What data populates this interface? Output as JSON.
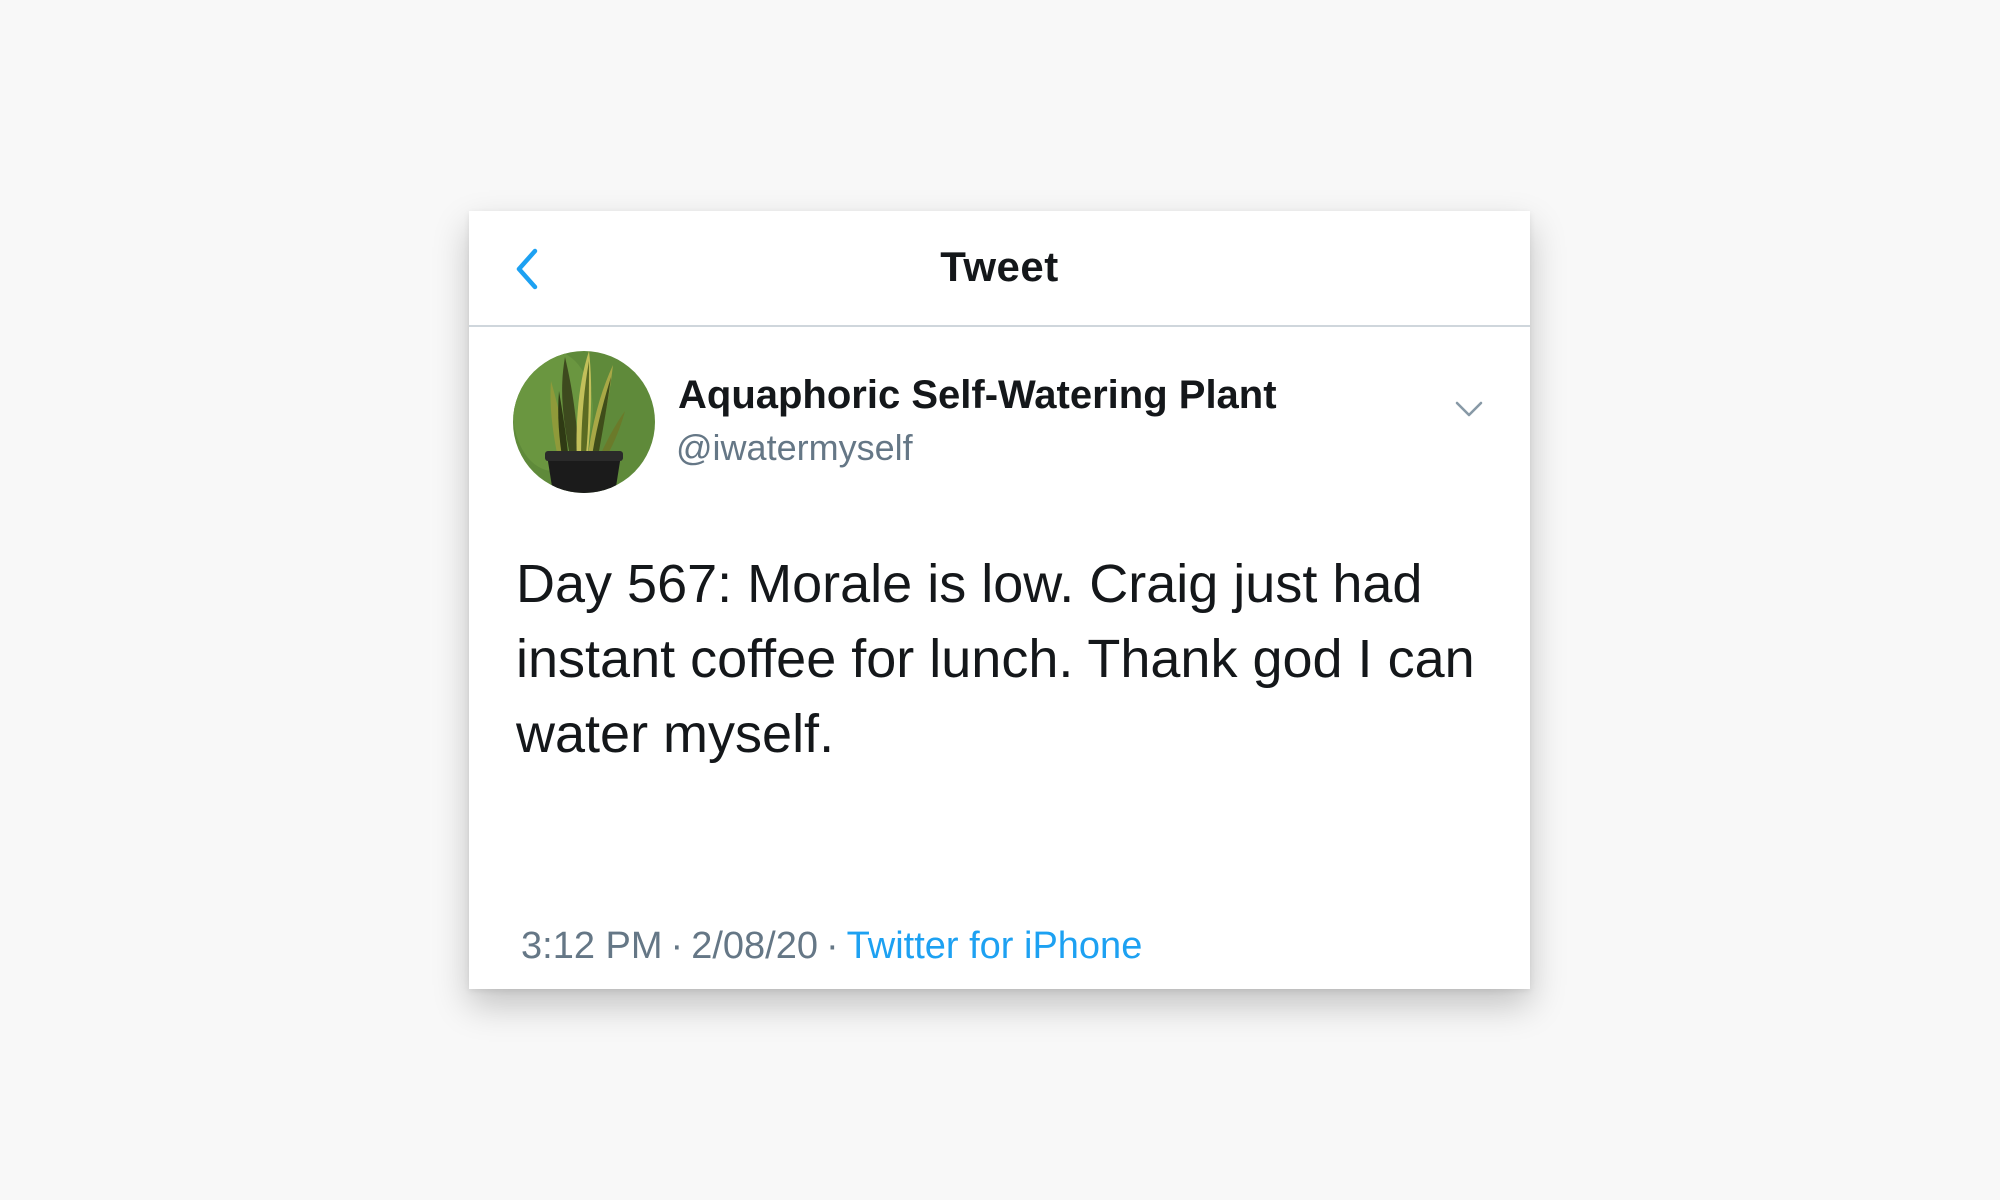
{
  "header": {
    "title": "Tweet",
    "back_icon": "chevron-left-icon",
    "accent_color": "#1da1f2"
  },
  "tweet": {
    "author": {
      "display_name": "Aquaphoric Self-Watering Plant",
      "handle": "@iwatermyself",
      "avatar_icon": "plant-avatar"
    },
    "menu_icon": "chevron-down-icon",
    "text": "Day 567: Morale is low. Craig just had instant coffee for lunch. Thank god I can water myself.",
    "time": "3:12 PM",
    "separator": "·",
    "date": "2/08/20",
    "source": "Twitter for iPhone"
  }
}
